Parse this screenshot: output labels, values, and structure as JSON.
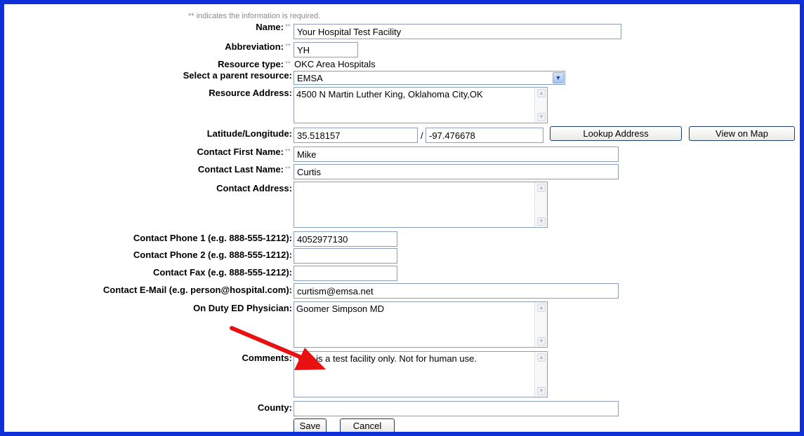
{
  "note": "** indicates the information is required.",
  "req_marker": "**",
  "slash": "/",
  "fields": {
    "name": {
      "label": "Name:",
      "value": "Your Hospital Test Facility"
    },
    "abbreviation": {
      "label": "Abbreviation:",
      "value": "YH"
    },
    "resource_type": {
      "label": "Resource type:",
      "value": "OKC Area Hospitals"
    },
    "parent": {
      "label": "Select a parent resource:",
      "value": "EMSA"
    },
    "address": {
      "label": "Resource Address:",
      "value": "4500 N Martin Luther King, Oklahoma City,OK"
    },
    "latlon": {
      "label": "Latitude/Longitude:",
      "lat": "35.518157",
      "lon": "-97.476678"
    },
    "first_name": {
      "label": "Contact First Name:",
      "value": "Mike"
    },
    "last_name": {
      "label": "Contact Last Name:",
      "value": "Curtis"
    },
    "contact_address": {
      "label": "Contact Address:",
      "value": ""
    },
    "phone1": {
      "label": "Contact Phone 1 (e.g. 888-555-1212):",
      "value": "4052977130"
    },
    "phone2": {
      "label": "Contact Phone 2 (e.g. 888-555-1212):",
      "value": ""
    },
    "fax": {
      "label": "Contact Fax (e.g. 888-555-1212):",
      "value": ""
    },
    "email": {
      "label": "Contact E-Mail (e.g. person@hospital.com):",
      "value": "curtism@emsa.net"
    },
    "physician": {
      "label": "On Duty ED Physician:",
      "value": "Goomer Simpson MD"
    },
    "comments": {
      "label": "Comments:",
      "value": "This is a test facility only.  Not for human use."
    },
    "county": {
      "label": "County:",
      "value": ""
    }
  },
  "buttons": {
    "lookup": "Lookup Address",
    "map": "View on Map",
    "save": "Save",
    "cancel": "Cancel"
  },
  "colors": {
    "frame": "#0f2fd8",
    "annotation_arrow": "#e81010"
  },
  "icons": {
    "scroll_up": "▲",
    "scroll_down": "▼",
    "dropdown": "▼"
  }
}
